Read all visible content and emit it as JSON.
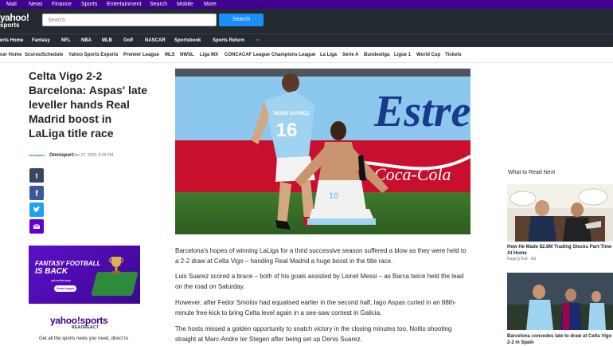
{
  "topbar": {
    "items": [
      "Mail",
      "News",
      "Finance",
      "Sports",
      "Entertainment",
      "Search",
      "Mobile",
      "More"
    ]
  },
  "header": {
    "logo_main": "yahoo!",
    "logo_sub": "sports",
    "search_placeholder": "Search",
    "search_button": "Search"
  },
  "sports_nav": {
    "items": [
      "Sports Home",
      "Fantasy",
      "NFL",
      "NBA",
      "MLB",
      "Golf",
      "NASCAR",
      "Sportsbook",
      "Sports Return",
      "···"
    ]
  },
  "soccer_nav": {
    "items": [
      "Soccer Home",
      "Scores/Schedule",
      "Yahoo Sports Experts",
      "Premier League",
      "MLS",
      "NWSL",
      "Liga MX",
      "CONCACAF League",
      "Champions League",
      "La Liga",
      "Serie A",
      "Bundesliga",
      "Ligue 1",
      "World Cup",
      "Tickets"
    ]
  },
  "article": {
    "headline": "Celta Vigo 2-2 Barcelona: Aspas' late leveller hands Real Madrid boost in LaLiga title race",
    "source_logo": "Omnisport",
    "author": "Omnisport",
    "date": "Jun 27, 2020, 8:04 PM",
    "paragraphs": [
      "Barcelona's hopes of winning LaLiga for a third successive season suffered a blow as they were held to a 2-2 draw at Celta Vigo – handing Real Madrid a huge boost in the title race.",
      "Luis Suarez scored a brace – both of his goals assisted by Lionel Messi – as Barca twice held the lead on the road on Saturday.",
      "However, after Fedor Smolov had equalised earlier in the second half, Iago Aspas curled in an 88th-minute free-kick to bring Celta level again in a see-saw contest in Galicia.",
      "The hosts missed a golden opportunity to snatch victory in the closing minutes too, Nolito shooting straight at Marc-Andre ter Stegen after being set up Denis Suarez."
    ],
    "hero_banner_text": "Estre",
    "player_back_name": "DENIS SUÁREZ",
    "player_back_number": "16",
    "player_front_number": "10"
  },
  "share": {
    "colors": {
      "tumblr": "#36465d",
      "facebook": "#3b5998",
      "twitter": "#1da1f2",
      "email": "#6001d2"
    }
  },
  "ad": {
    "line1": "FANTASY FOOTBALL",
    "line2": "IS BACK",
    "brand": "yahoo!fantasy",
    "cta": "Create league"
  },
  "newsletter": {
    "logo": "yahoo!sports",
    "tag": "READREACT",
    "text": "Get all the sports news you need, direct to"
  },
  "rail": {
    "title": "What to Read Next",
    "items": [
      {
        "title": "How He Made $2.8M Trading Stocks Part-Time At Home",
        "source": "Raging Bull",
        "badge": "Ad"
      },
      {
        "title": "Barcelona concedes late to draw at Celta Vigo 2-2 in Spain"
      }
    ]
  },
  "colors": {
    "brand_purple": "#400090",
    "header_dark": "#232a31",
    "search_blue": "#188fff",
    "celta_sky": "#8cc8ee"
  }
}
